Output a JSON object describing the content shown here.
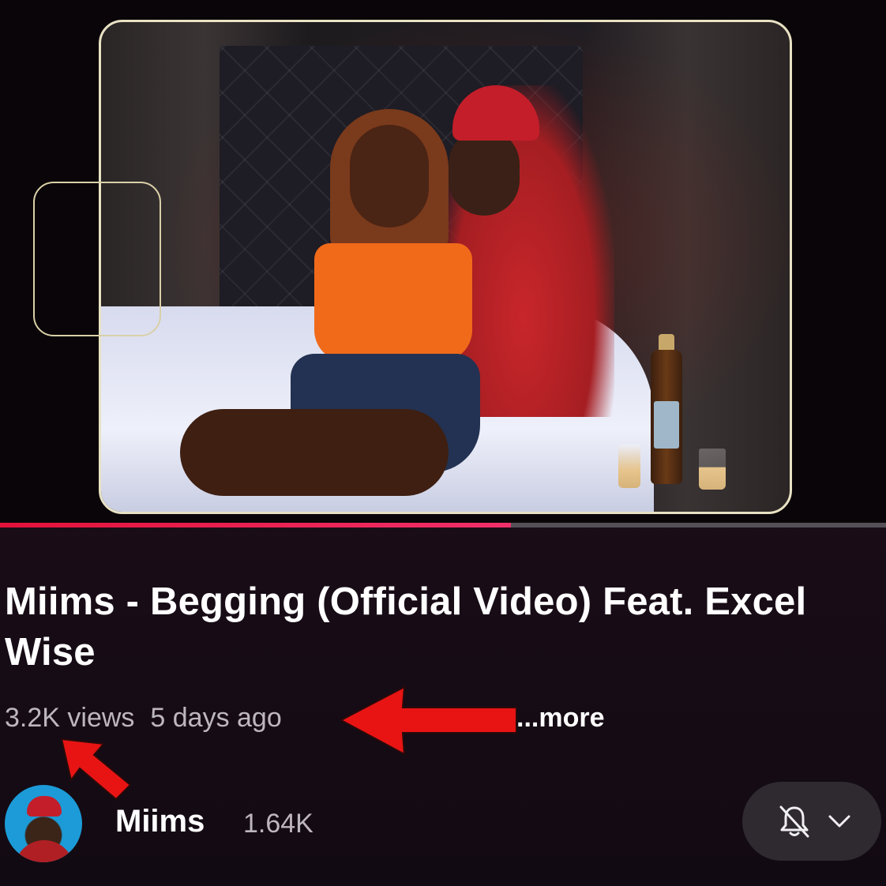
{
  "video": {
    "title": "Miims - Begging (Official Video) Feat. Excel Wise",
    "views": "3.2K views",
    "age": "5 days ago",
    "more_label": "...more",
    "progress_fraction": 0.577
  },
  "channel": {
    "name": "Miims",
    "subscribers": "1.64K"
  },
  "icons": {
    "bell": "bell-off-icon",
    "chevron": "chevron-down-icon"
  },
  "colors": {
    "progress": "#e2123a",
    "annotation_arrow": "#e81414"
  }
}
